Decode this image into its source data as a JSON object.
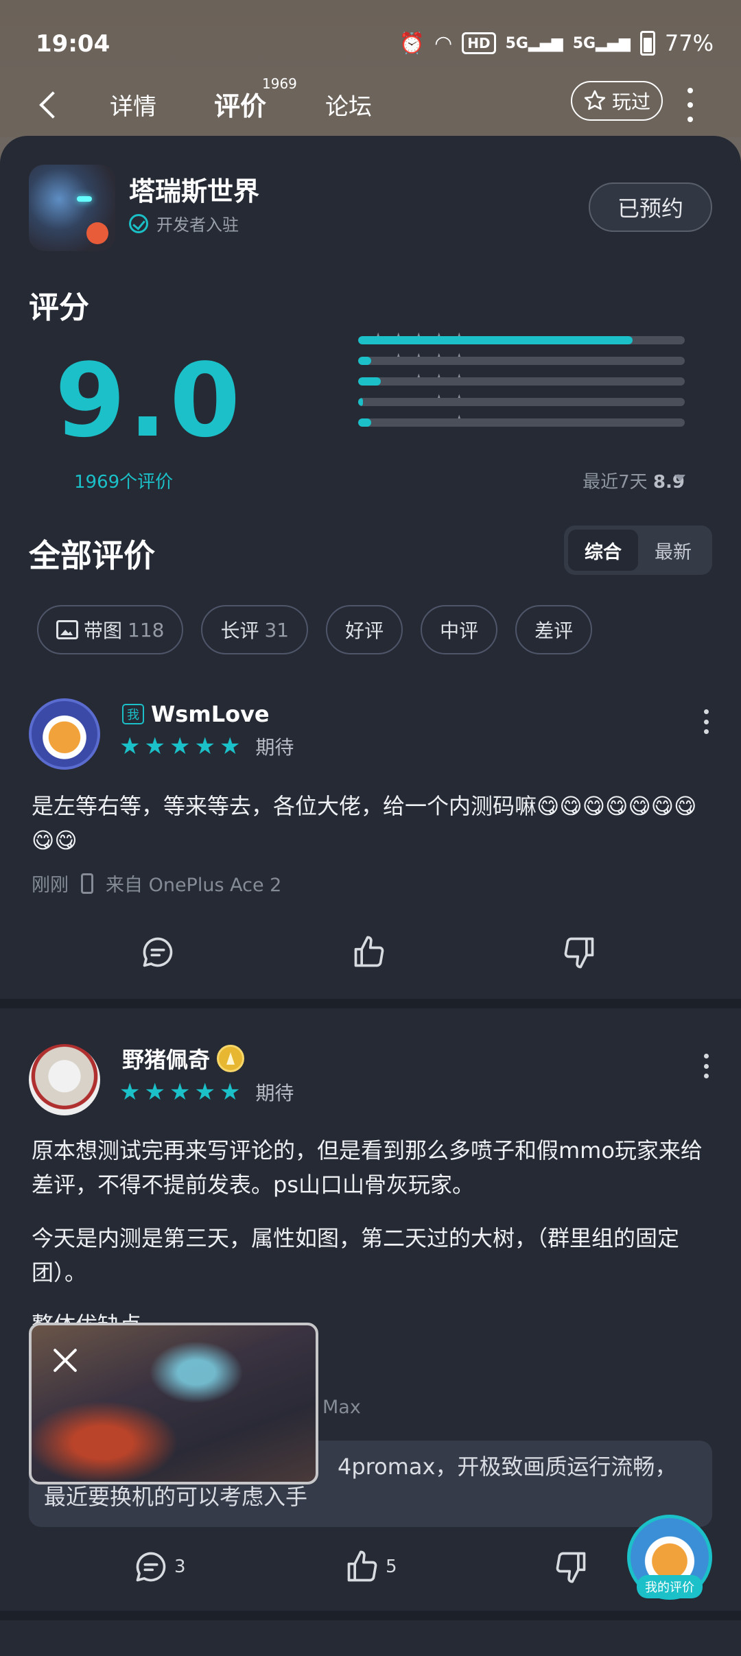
{
  "status_bar": {
    "time": "19:04",
    "network": "5G",
    "battery": "77%",
    "hd_label": "HD"
  },
  "nav": {
    "tabs": [
      {
        "label": "详情"
      },
      {
        "label": "评价",
        "count": "1969",
        "active": true
      },
      {
        "label": "论坛"
      }
    ],
    "played_label": "玩过"
  },
  "game": {
    "title": "塔瑞斯世界",
    "badge": "开发者入驻",
    "reserve_label": "已预约"
  },
  "rating": {
    "heading": "评分",
    "score": "9.0",
    "count_label": "1969个评价",
    "distribution": [
      {
        "stars": 5,
        "fraction": 0.84
      },
      {
        "stars": 4,
        "fraction": 0.04
      },
      {
        "stars": 3,
        "fraction": 0.07
      },
      {
        "stars": 2,
        "fraction": 0.015
      },
      {
        "stars": 1,
        "fraction": 0.04
      }
    ],
    "recent_label": "最近7天",
    "recent_score": "8.9"
  },
  "all_reviews": {
    "heading": "全部评价",
    "sort_options": [
      {
        "label": "综合",
        "active": true
      },
      {
        "label": "最新",
        "active": false
      }
    ],
    "filters": [
      {
        "label": "带图",
        "count": "118",
        "icon": "picture-icon"
      },
      {
        "label": "长评",
        "count": "31"
      },
      {
        "label": "好评"
      },
      {
        "label": "中评"
      },
      {
        "label": "差评"
      }
    ]
  },
  "reviews": [
    {
      "me_tag": "我",
      "user": "WsmLove",
      "stars": 5,
      "status": "期待",
      "text": "是左等右等，等来等去，各位大佬，给一个内测码嘛😋😋😋😋😋😋😋😋😋",
      "time": "刚刚",
      "device": "来自 OnePlus Ace 2"
    },
    {
      "user": "野猪佩奇",
      "stars": 5,
      "status": "期待",
      "paragraphs": [
        "原本想测试完再来写评论的，但是看到那么多喷子和假mmo玩家来给差评，不得不提前发表。ps山口山骨灰玩家。",
        "今天是内测是第三天，属性如图，第二天过的大树，（群里组的固定团）。",
        "整体优缺点"
      ],
      "device_fragment": "Max",
      "quote": "4promax，开极致画质运行流畅，最近要换机的可以考虑入手",
      "comments": "3",
      "likes": "5"
    }
  ],
  "fab": {
    "label": "我的评价"
  },
  "colors": {
    "accent": "#1bc0c8",
    "sheet_bg": "#252a34",
    "backdrop": "#6d645c"
  }
}
